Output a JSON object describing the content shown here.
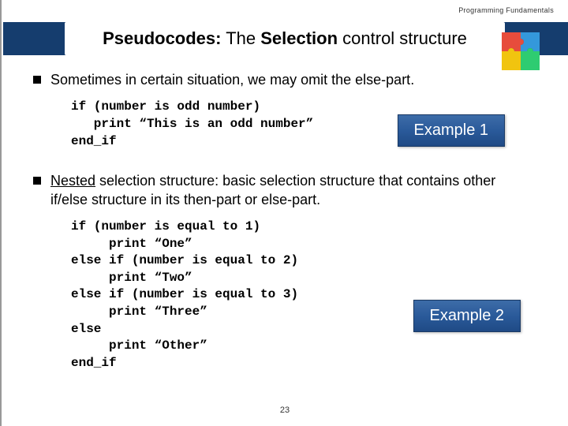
{
  "header": "Programming Fundamentals",
  "title": {
    "bold1": "Pseudocodes:",
    "plain1": " The ",
    "bold2": "Selection",
    "plain2": " control structure"
  },
  "bullet1": "Sometimes in certain situation, we may omit the else-part.",
  "code1": "if (number is odd number)\n   print “This is an odd number”\nend_if",
  "example1": "Example 1",
  "bullet2": {
    "u": "Nested",
    "rest": " selection structure: basic selection structure that contains other if/else structure in its then-part or else-part."
  },
  "code2": "if (number is equal to 1)\n     print “One”\nelse if (number is equal to 2)\n     print “Two”\nelse if (number is equal to 3)\n     print “Three”\nelse\n     print “Other”\nend_if",
  "example2": "Example 2",
  "page": "23"
}
